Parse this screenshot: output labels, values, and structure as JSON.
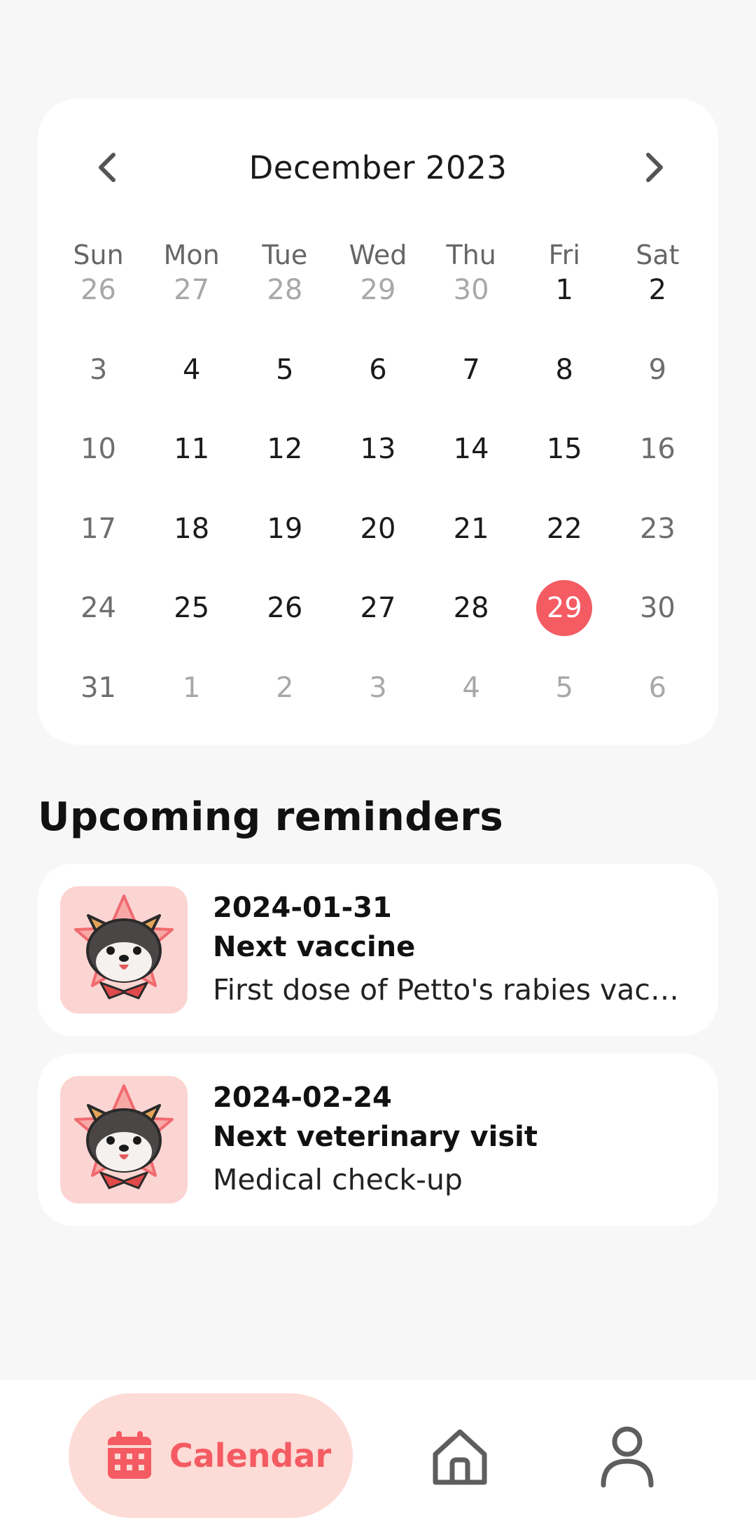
{
  "calendar": {
    "month_title": "December 2023",
    "weekdays": [
      "Sun",
      "Mon",
      "Tue",
      "Wed",
      "Thu",
      "Fri",
      "Sat"
    ],
    "days": [
      "26",
      "27",
      "28",
      "29",
      "30",
      "1",
      "2",
      "3",
      "4",
      "5",
      "6",
      "7",
      "8",
      "9",
      "10",
      "11",
      "12",
      "13",
      "14",
      "15",
      "16",
      "17",
      "18",
      "19",
      "20",
      "21",
      "22",
      "23",
      "24",
      "25",
      "26",
      "27",
      "28",
      "29",
      "30",
      "31",
      "1",
      "2",
      "3",
      "4",
      "5",
      "6"
    ],
    "selected_day": "29",
    "accent_color": "#f45b62"
  },
  "reminders": {
    "title": "Upcoming reminders",
    "items": [
      {
        "date": "2024-01-31",
        "title": "Next vaccine",
        "description": "First dose of Petto's rabies vaccine"
      },
      {
        "date": "2024-02-24",
        "title": "Next veterinary visit",
        "description": "Medical check-up"
      }
    ]
  },
  "bottom_nav": {
    "calendar_label": "Calendar",
    "items": [
      "calendar-icon",
      "home-icon",
      "profile-icon"
    ]
  }
}
